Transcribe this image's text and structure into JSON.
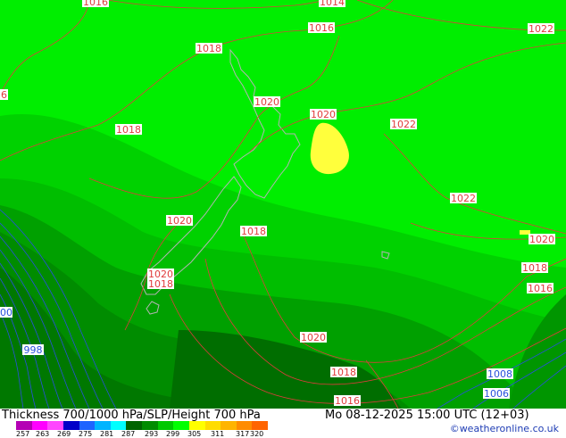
{
  "map": {
    "isobar_labels_red": [
      "1016",
      "1014",
      "1016",
      "1022",
      "1018",
      "1020",
      "1018",
      "1020",
      "1022",
      "1022",
      "1020",
      "1018",
      "1020",
      "1018",
      "1016",
      "1020",
      "1018",
      "1020",
      "1018",
      "1016",
      "6"
    ],
    "isobar_labels_blue": [
      "998",
      "00",
      "1008",
      "1006"
    ]
  },
  "footer": {
    "title": "Thickness 700/1000 hPa/SLP/Height 700 hPa",
    "datetime": "Mo 08-12-2025 15:00 UTC (12+03)",
    "credit": "©weatheronline.co.uk",
    "scale_ticks": [
      "257",
      "263",
      "269",
      "275",
      "281",
      "287",
      "293",
      "299",
      "305",
      "311",
      "317",
      "320"
    ],
    "scale_colors": [
      "#b400b4",
      "#ff00ff",
      "#ff46ff",
      "#0000c8",
      "#1e64ff",
      "#00b4ff",
      "#00ffff",
      "#006400",
      "#008c00",
      "#00c800",
      "#00ff00",
      "#ffff00",
      "#ffdc00",
      "#ffb400",
      "#ff8c00",
      "#ff6400"
    ]
  },
  "colors": {
    "field_light": "#00ee00",
    "field_mid": "#00cc00",
    "field_dark": "#009600",
    "field_darker": "#007a00",
    "field_darkest": "#006400",
    "warm_patch": "#ffff3c",
    "isobar": "#e03c3c",
    "isohypse": "#2850dc"
  }
}
